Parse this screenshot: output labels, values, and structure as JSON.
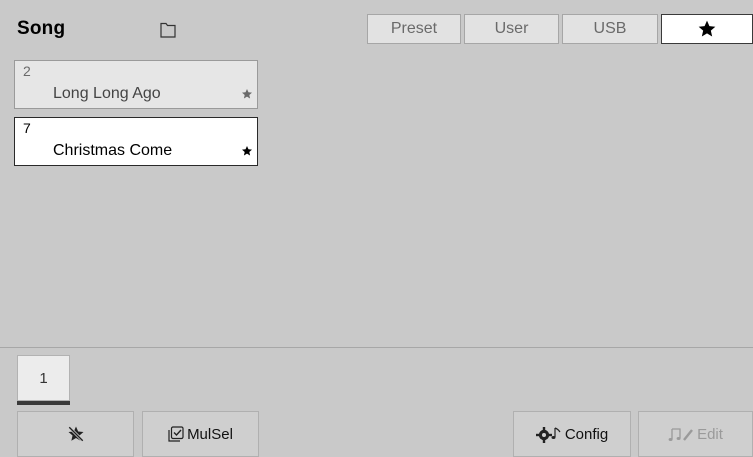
{
  "header": {
    "title": "Song",
    "tabs": [
      {
        "label": "Preset",
        "active": false
      },
      {
        "label": "User",
        "active": false
      },
      {
        "label": "USB",
        "active": false
      },
      {
        "label": "",
        "icon": "star-icon",
        "active": true
      }
    ]
  },
  "songs": [
    {
      "number": "2",
      "name": "Long Long Ago",
      "favorite_icon": "star-icon",
      "selected": false
    },
    {
      "number": "7",
      "name": "Christmas Come",
      "favorite_icon": "star-icon",
      "selected": true
    }
  ],
  "pagination": {
    "current_page": "1"
  },
  "toolbar": {
    "unfavorite_icon": "star-off-icon",
    "mulsel_label": "MulSel",
    "mulsel_icon": "multi-select-icon",
    "config_label": "Config",
    "config_icon": "gear-note-icon",
    "edit_label": "Edit",
    "edit_icon": "note-pencil-icon",
    "edit_disabled": true
  },
  "colors": {
    "background": "#c9c9c9",
    "tab_inactive": "#e2e2e2",
    "tab_active": "#ffffff",
    "card_selected": "#ffffff",
    "card_normal": "#e6e6e6"
  }
}
